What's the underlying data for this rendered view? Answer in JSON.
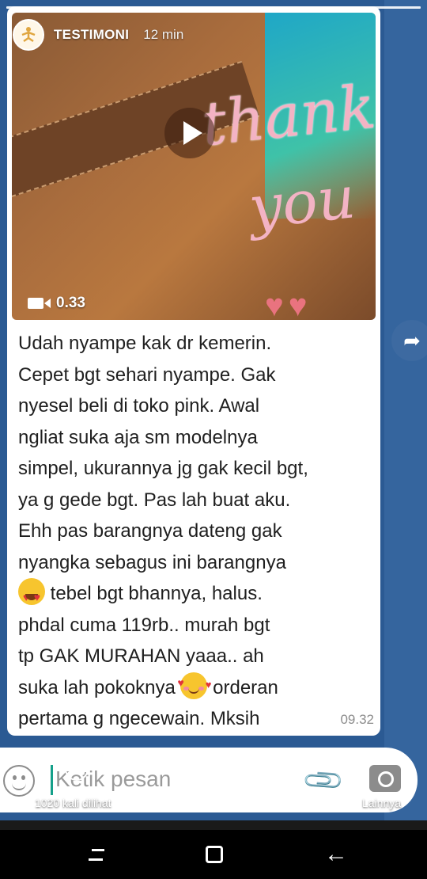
{
  "story": {
    "name": "TESTIMONI",
    "time": "12 min",
    "segments": 1
  },
  "media": {
    "duration": "0.33",
    "overlay_line1": "thank",
    "overlay_line2": "you",
    "hearts": "♥♥",
    "play_icon": "play-icon"
  },
  "message": {
    "part1": "Udah nyampe kak dr kemerin.\nCepet bgt sehari nyampe. Gak\nnyesel beli di toko pink. Awal\nngliat suka aja sm modelnya\nsimpel, ukurannya jg gak kecil bgt,\nya g gede bgt. Pas lah buat aku.\nEhh pas barangnya dateng gak\nnyangka sebagus ini barangnya\n",
    "part2": " tebel bgt bhannya, halus.\nphdal cuma 119rb.. murah bgt\ntp GAK MURAHAN yaaa.. ah\nsuka lah pokoknya ",
    "part3": " orderan\npertama g ngecewain. Mksih\nbnyak kak",
    "time": "09.32",
    "emoji1": "heart-eyes-emoji",
    "emoji2": "smiling-face-with-hearts-emoji"
  },
  "input": {
    "placeholder": "Ketik pesan"
  },
  "footer": {
    "views": "1020 kali dilihat",
    "more": "Lainnya"
  },
  "colors": {
    "background": "#2b5a93",
    "accent": "#15a08a",
    "overlay_pink": "#f3b3c4"
  }
}
